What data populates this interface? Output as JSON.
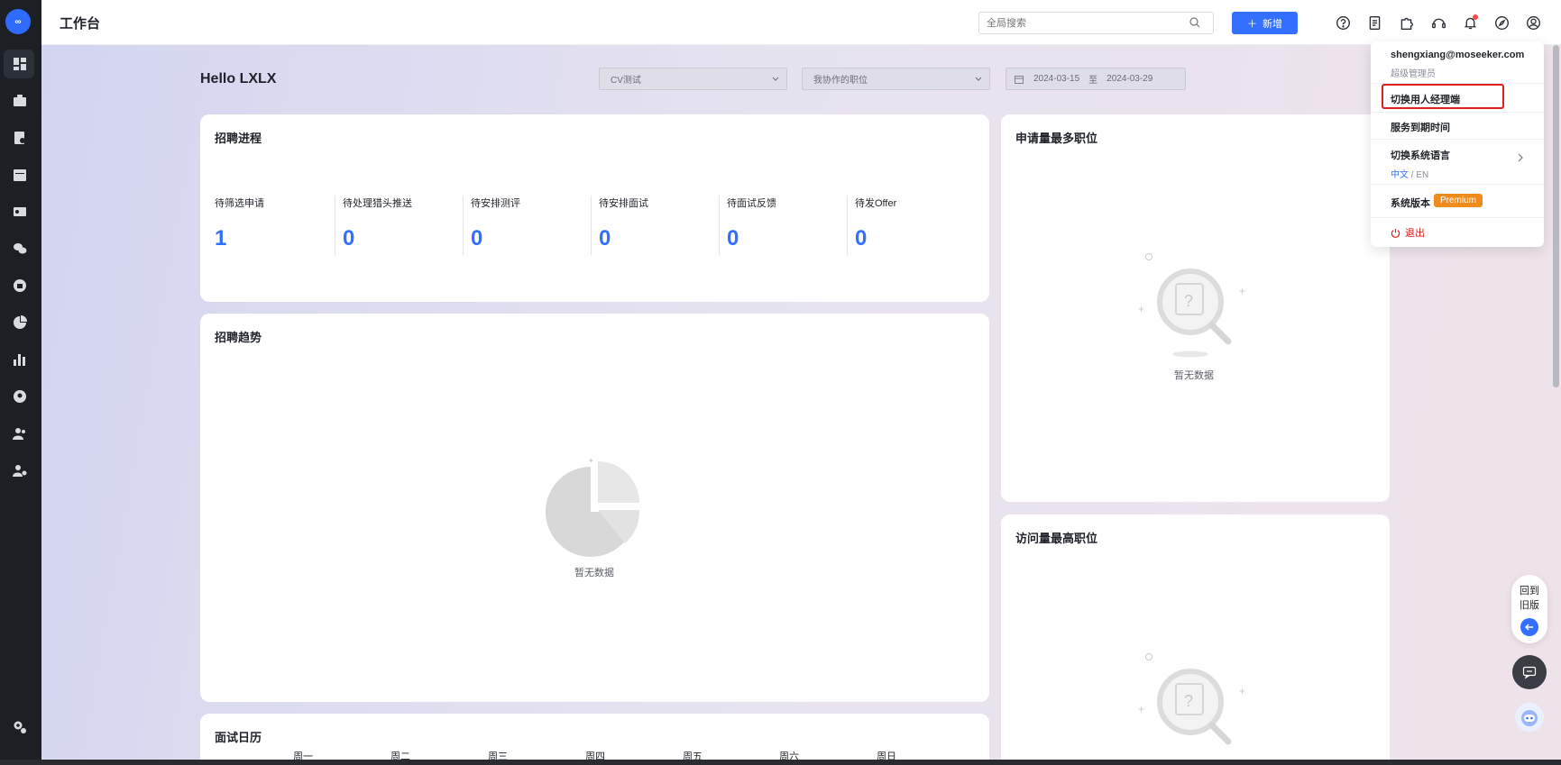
{
  "header": {
    "title": "工作台",
    "search_placeholder": "全局搜索",
    "new_button": "新增"
  },
  "main": {
    "greeting": "Hello LXLX",
    "filters": {
      "cv_select": "CV测试",
      "position_select": "我协作的职位",
      "date_start": "2024-03-15",
      "date_sep": "至",
      "date_end": "2024-03-29"
    },
    "progress": {
      "title": "招聘进程",
      "stats": [
        {
          "label": "待筛选申请",
          "value": "1"
        },
        {
          "label": "待处理猎头推送",
          "value": "0"
        },
        {
          "label": "待安排测评",
          "value": "0"
        },
        {
          "label": "待安排面试",
          "value": "0"
        },
        {
          "label": "待面试反馈",
          "value": "0"
        },
        {
          "label": "待发Offer",
          "value": "0"
        }
      ]
    },
    "trend": {
      "title": "招聘趋势",
      "empty": "暂无数据"
    },
    "calendar": {
      "title": "面试日历",
      "weekdays": [
        "周一",
        "周二",
        "周三",
        "周四",
        "周五",
        "周六",
        "周日"
      ]
    },
    "most_applied": {
      "title": "申请量最多职位",
      "empty": "暂无数据"
    },
    "most_visited": {
      "title": "访问量最高职位"
    }
  },
  "user_menu": {
    "email": "shengxiang@moseeker.com",
    "role": "超级管理员",
    "switch_manager": "切换用人经理端",
    "service_expiry": "服务到期时间",
    "switch_language": "切换系统语言",
    "lang_cn": "中文",
    "lang_en": "/ EN",
    "system_version": "系统版本",
    "version_badge": "Premium",
    "logout": "退出"
  },
  "float": {
    "back_old": "回到旧版"
  },
  "colors": {
    "primary": "#3370ff",
    "sidebar": "#1c1f24",
    "highlight": "#e02020",
    "premium": "#f08b1e"
  }
}
